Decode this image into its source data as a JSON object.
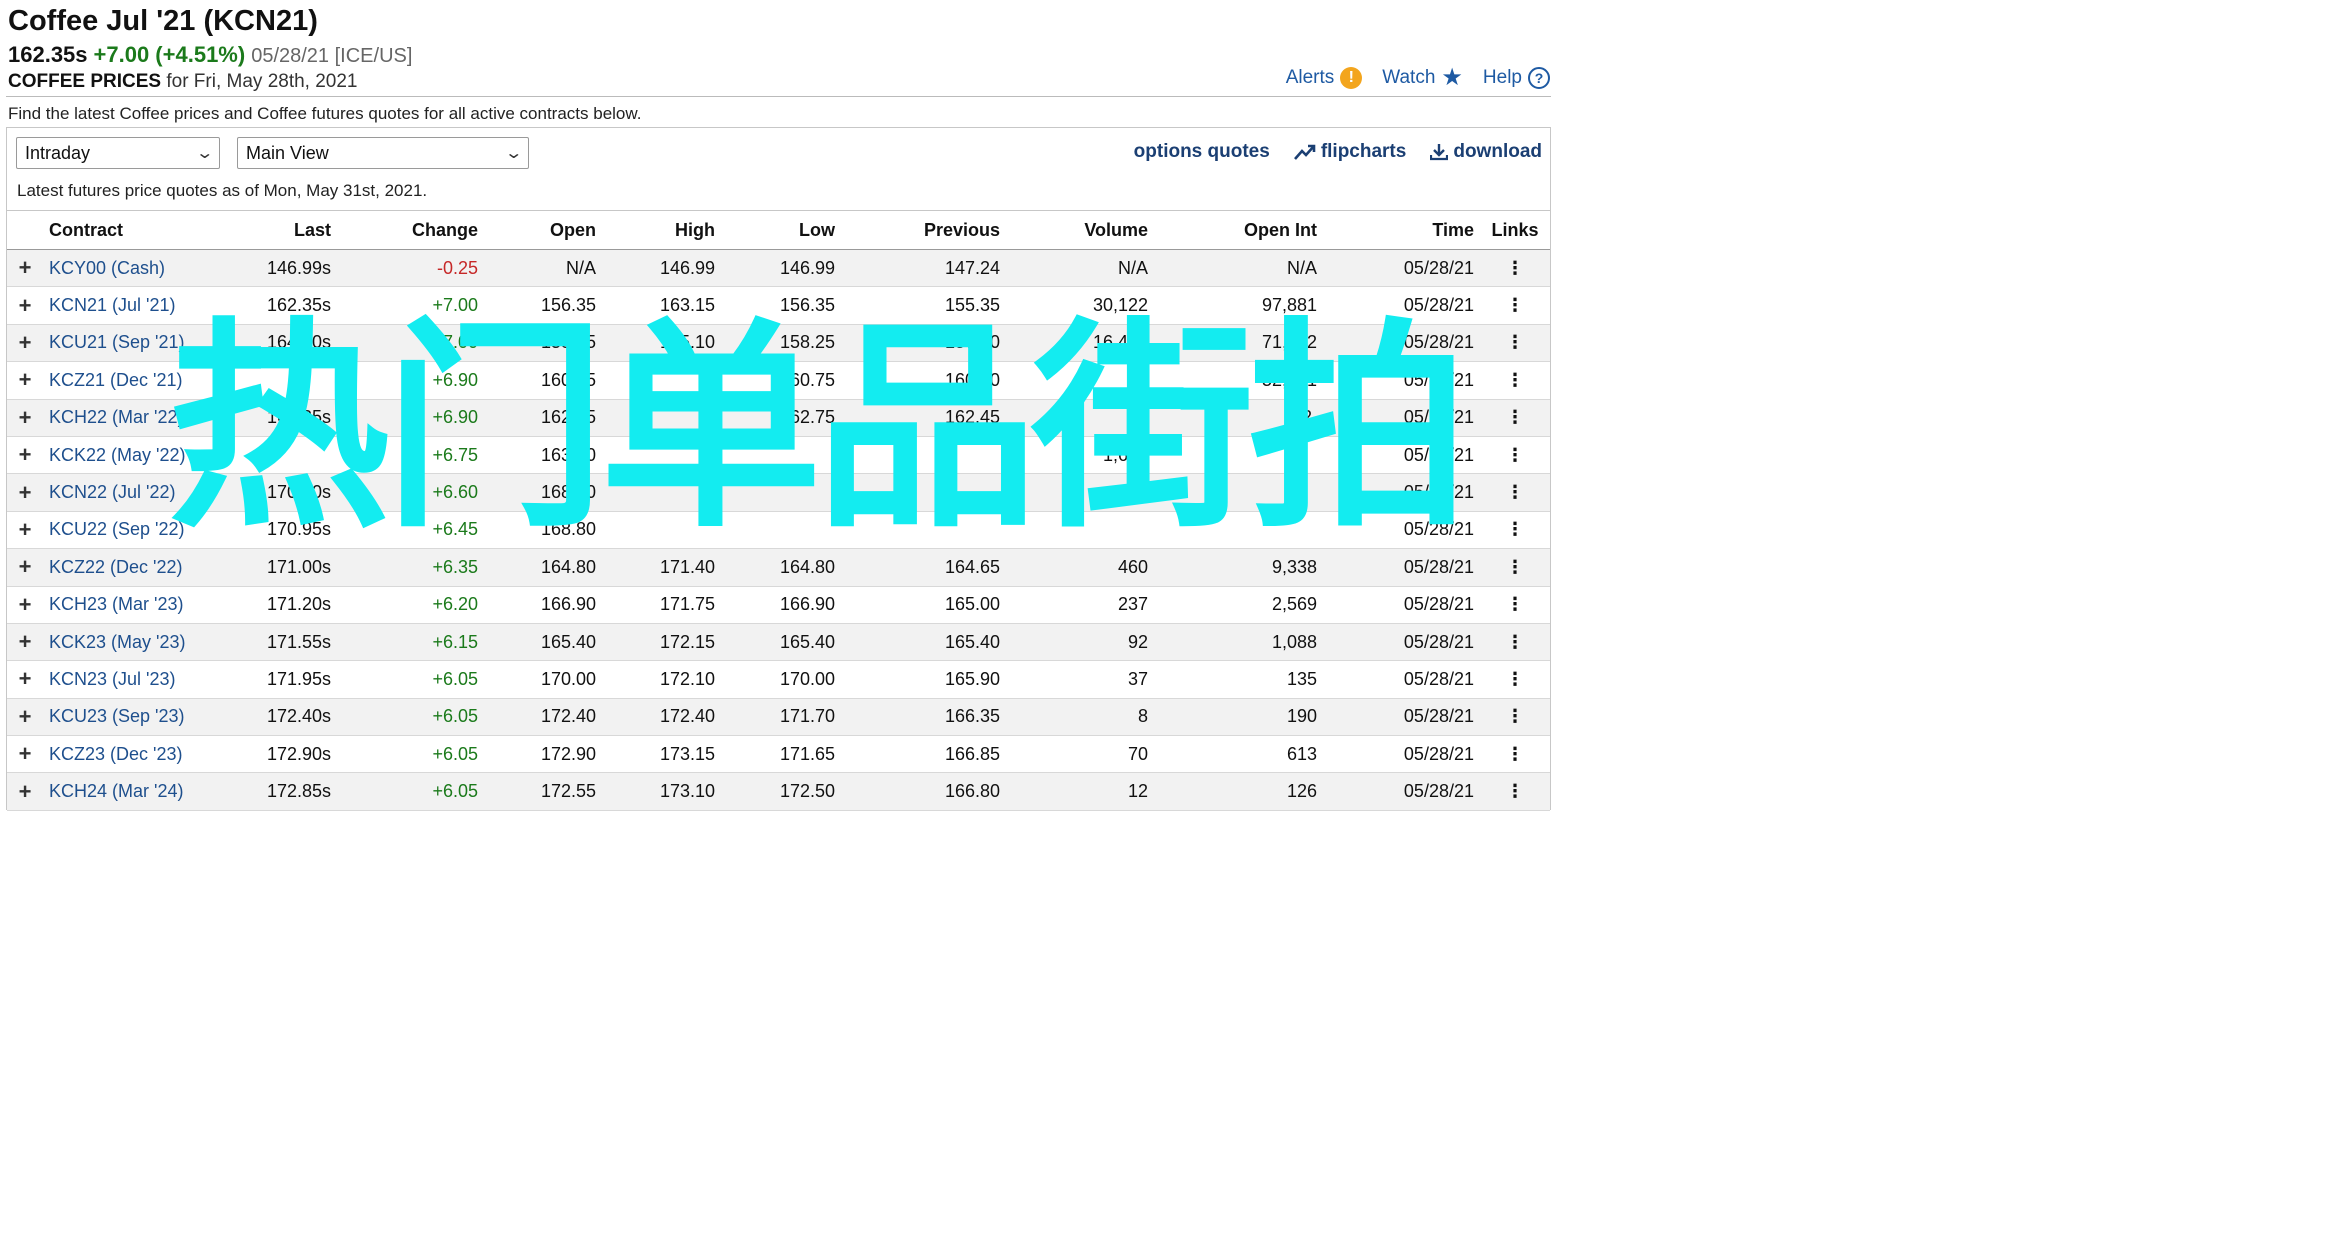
{
  "header": {
    "title": "Coffee Jul '21 (KCN21)",
    "last": "162.35s",
    "change": "+7.00 (+4.51%)",
    "meta": "05/28/21 [ICE/US]",
    "subtitle_bold": "COFFEE PRICES",
    "subtitle_rest": "for Fri, May 28th, 2021",
    "links": {
      "alerts": "Alerts",
      "watch": "Watch",
      "help": "Help"
    }
  },
  "intro": "Find the latest Coffee prices and Coffee futures quotes for all active contracts below.",
  "controls": {
    "period_select": "Intraday",
    "view_select": "Main View",
    "tools": {
      "options": "options quotes",
      "flipcharts": "flipcharts",
      "download": "download"
    },
    "as_of": "Latest futures price quotes as of Mon, May 31st, 2021."
  },
  "table": {
    "headers": [
      "Contract",
      "Last",
      "Change",
      "Open",
      "High",
      "Low",
      "Previous",
      "Volume",
      "Open Int",
      "Time",
      "Links"
    ],
    "rows": [
      [
        "KCY00 (Cash)",
        "146.99s",
        "-0.25",
        "N/A",
        "146.99",
        "146.99",
        "147.24",
        "N/A",
        "N/A",
        "05/28/21"
      ],
      [
        "KCN21 (Jul '21)",
        "162.35s",
        "+7.00",
        "156.35",
        "163.15",
        "156.35",
        "155.35",
        "30,122",
        "97,881",
        "05/28/21"
      ],
      [
        "KCU21 (Sep '21)",
        "164.30s",
        "+7.00",
        "158.25",
        "165.10",
        "158.25",
        "157.30",
        "16,447",
        "71,562",
        "05/28/21"
      ],
      [
        "KCZ21 (Dec '21)",
        "",
        "+6.90",
        "160.75",
        "",
        "160.75",
        "160.10",
        "",
        "52,221",
        "05/28/21"
      ],
      [
        "KCH22 (Mar '22)",
        "169.35s",
        "+6.90",
        "162.75",
        "",
        "162.75",
        "162.45",
        "",
        "32,",
        "05/28/21"
      ],
      [
        "KCK22 (May '22)",
        "",
        "+6.75",
        "163.50",
        "",
        "",
        "",
        "1,622",
        "",
        "05/28/21"
      ],
      [
        "KCN22 (Jul '22)",
        "170.80s",
        "+6.60",
        "168.00",
        "",
        "",
        "",
        "807",
        "",
        "05/28/21"
      ],
      [
        "KCU22 (Sep '22)",
        "170.95s",
        "+6.45",
        "168.80",
        "",
        "",
        "",
        "",
        "",
        "05/28/21"
      ],
      [
        "KCZ22 (Dec '22)",
        "171.00s",
        "+6.35",
        "164.80",
        "171.40",
        "164.80",
        "164.65",
        "460",
        "9,338",
        "05/28/21"
      ],
      [
        "KCH23 (Mar '23)",
        "171.20s",
        "+6.20",
        "166.90",
        "171.75",
        "166.90",
        "165.00",
        "237",
        "2,569",
        "05/28/21"
      ],
      [
        "KCK23 (May '23)",
        "171.55s",
        "+6.15",
        "165.40",
        "172.15",
        "165.40",
        "165.40",
        "92",
        "1,088",
        "05/28/21"
      ],
      [
        "KCN23 (Jul '23)",
        "171.95s",
        "+6.05",
        "170.00",
        "172.10",
        "170.00",
        "165.90",
        "37",
        "135",
        "05/28/21"
      ],
      [
        "KCU23 (Sep '23)",
        "172.40s",
        "+6.05",
        "172.40",
        "172.40",
        "171.70",
        "166.35",
        "8",
        "190",
        "05/28/21"
      ],
      [
        "KCZ23 (Dec '23)",
        "172.90s",
        "+6.05",
        "172.90",
        "173.15",
        "171.65",
        "166.85",
        "70",
        "613",
        "05/28/21"
      ],
      [
        "KCH24 (Mar '24)",
        "172.85s",
        "+6.05",
        "172.55",
        "173.10",
        "172.50",
        "166.80",
        "12",
        "126",
        "05/28/21"
      ]
    ]
  },
  "overlay": {
    "text": "热门单品街拍",
    "color": "#13ecf0"
  },
  "colors": {
    "positive": "#1b7a1b",
    "negative": "#c62828",
    "link": "#1e4f8d"
  }
}
